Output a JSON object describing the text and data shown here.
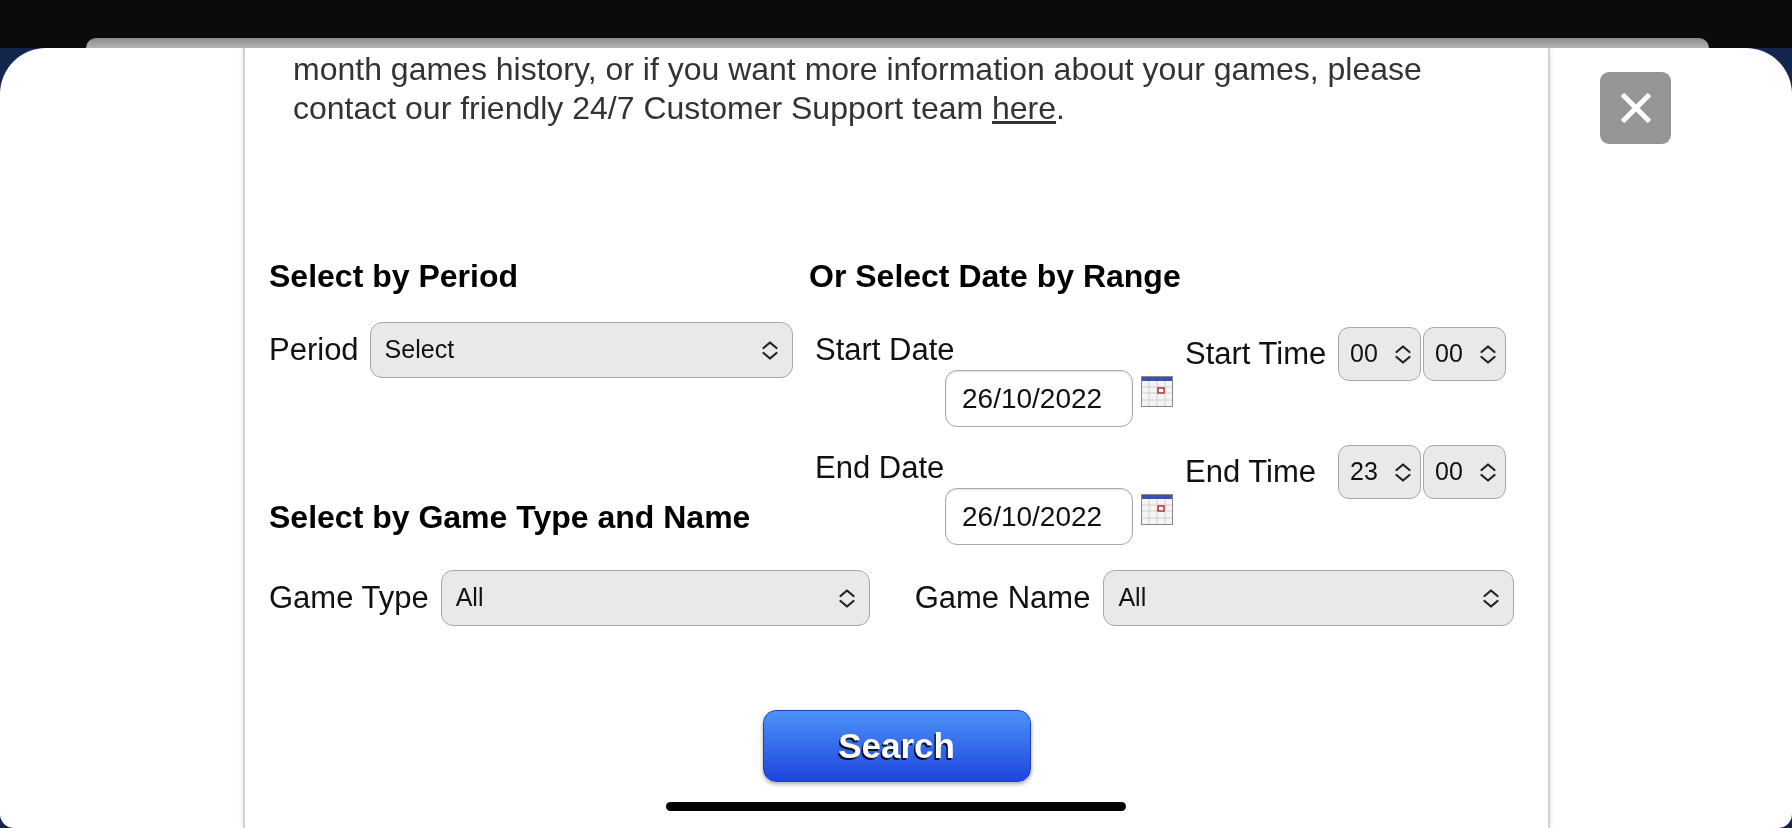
{
  "support_message": {
    "text": "month games history, or if you want more information about your games, please contact our friendly 24/7 Customer Support team ",
    "link": "here",
    "after": "."
  },
  "period_section": {
    "heading": "Select by Period",
    "field": {
      "label": "Period",
      "value": "Select"
    }
  },
  "date_range": {
    "heading": "Or Select Date by Range",
    "rows": [
      {
        "date_label": "Start Date",
        "date": "26/10/2022",
        "time_label": "Start Time",
        "hour": "00",
        "minute": "00"
      },
      {
        "date_label": "End Date",
        "date": "26/10/2022",
        "time_label": "End Time",
        "hour": "23",
        "minute": "00"
      }
    ]
  },
  "game_section": {
    "heading": "Select by Game Type and Name",
    "fields": [
      {
        "label": "Game Type",
        "value": "All"
      },
      {
        "label": "Game Name",
        "value": "All"
      }
    ]
  },
  "search_button": {
    "label": "Search"
  }
}
